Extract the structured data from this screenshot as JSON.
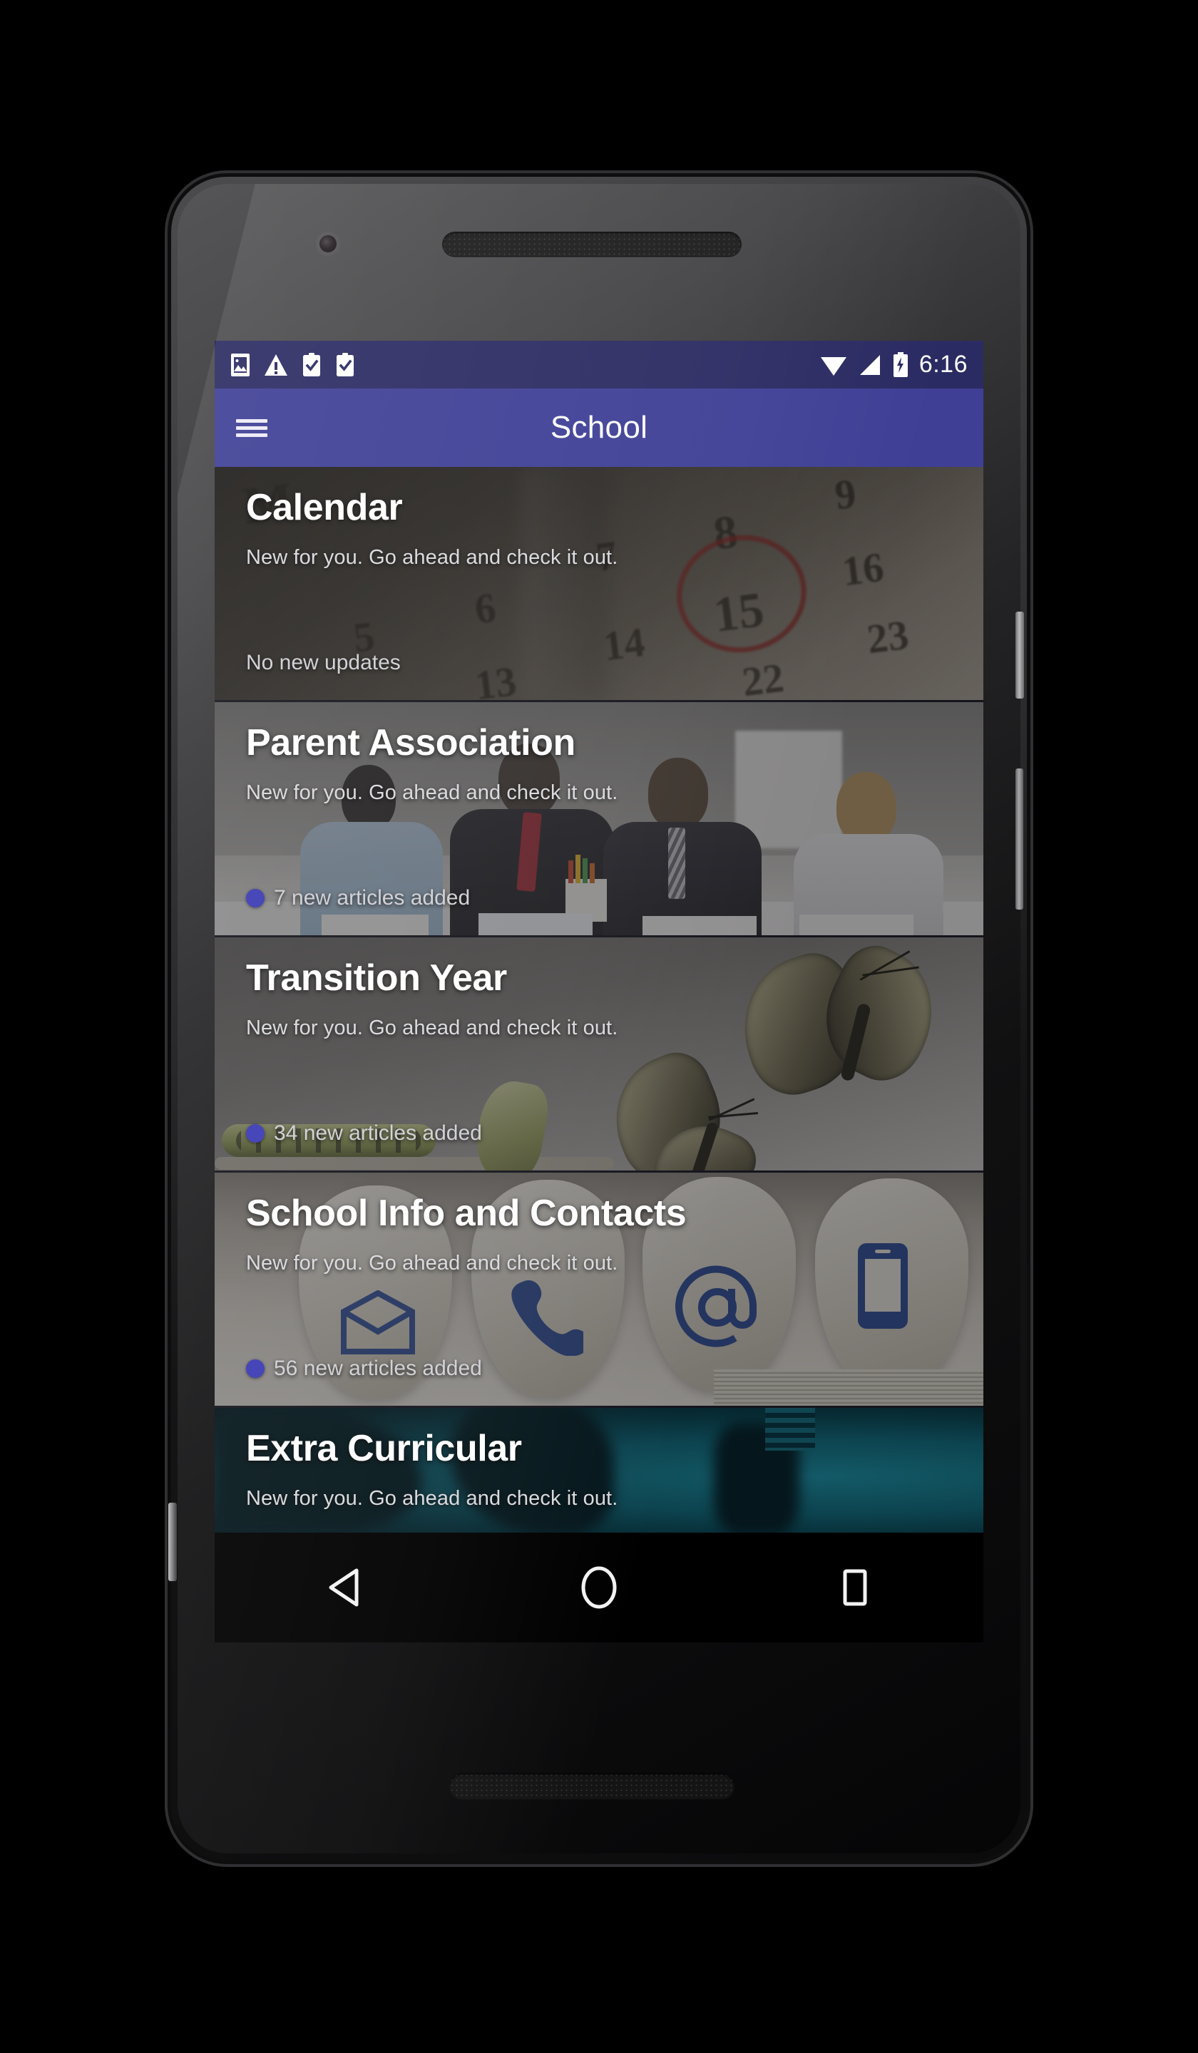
{
  "device": {
    "camera": "front-camera",
    "earpiece": "earpiece-speaker",
    "bottom_speaker": "bottom-speaker",
    "power_button": "power-button",
    "volume_button": "volume-rocker"
  },
  "status_bar": {
    "background_color": "#2b2b63",
    "time": "6:16",
    "left_icons": [
      "image-icon",
      "warning-icon",
      "clipboard-check-icon",
      "clipboard-check-icon"
    ],
    "right_icons": [
      "wifi-icon",
      "cellular-signal-icon",
      "battery-charging-icon"
    ]
  },
  "app_bar": {
    "background_color": "#3f3f96",
    "menu_icon": "hamburger-menu-icon",
    "title": "School"
  },
  "cards": [
    {
      "title": "Calendar",
      "subtitle": "New for you. Go ahead and check it out.",
      "status": "No new updates",
      "has_badge": false,
      "badge_color": "#3a3ab4",
      "art": "calendar"
    },
    {
      "title": "Parent Association",
      "subtitle": "New for you. Go ahead and check it out.",
      "status": "7 new articles added",
      "has_badge": true,
      "badge_color": "#3a3ab4",
      "art": "meeting"
    },
    {
      "title": "Transition Year",
      "subtitle": "New for you. Go ahead and check it out.",
      "status": "34 new articles added",
      "has_badge": true,
      "badge_color": "#3a3ab4",
      "art": "butterfly"
    },
    {
      "title": "School Info and Contacts",
      "subtitle": "New for you. Go ahead and check it out.",
      "status": "56 new articles added",
      "has_badge": true,
      "badge_color": "#3a3ab4",
      "art": "stones"
    },
    {
      "title": "Extra Curricular",
      "subtitle": "New for you. Go ahead and check it out.",
      "status": "",
      "has_badge": false,
      "badge_color": "#3a3ab4",
      "art": "teal"
    }
  ],
  "nav_bar": {
    "back": "back-triangle-icon",
    "home": "home-circle-icon",
    "recents": "recents-square-icon"
  },
  "calendar_art": {
    "numbers": [
      "M",
      "9",
      "7",
      "8",
      "16",
      "6",
      "15",
      "23",
      "5",
      "14",
      "22",
      "13"
    ]
  },
  "contact_icons": [
    "envelope-icon",
    "phone-icon",
    "at-sign-icon",
    "mobile-phone-icon"
  ]
}
